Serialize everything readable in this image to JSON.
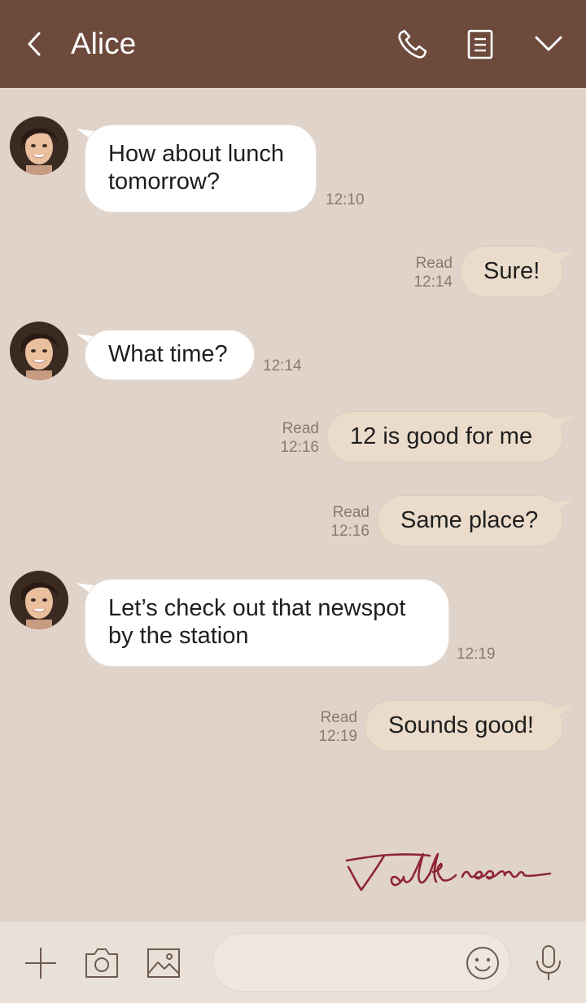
{
  "header": {
    "title": "Alice",
    "icons": [
      "back-arrow-icon",
      "phone-icon",
      "notes-icon",
      "chevron-down-icon"
    ],
    "background": "#6d4a3c"
  },
  "messages": [
    {
      "from": "Alice",
      "direction": "incoming",
      "text": "How about lunch\ntomorrow?",
      "time": "12:10"
    },
    {
      "from": "me",
      "direction": "outgoing",
      "text": "Sure!",
      "status": "Read",
      "time": "12:14"
    },
    {
      "from": "Alice",
      "direction": "incoming",
      "text": "What time?",
      "time": "12:14"
    },
    {
      "from": "me",
      "direction": "outgoing",
      "text": "12 is good for me",
      "status": "Read",
      "time": "12:16"
    },
    {
      "from": "me",
      "direction": "outgoing",
      "text": "Same place?",
      "status": "Read",
      "time": "12:16"
    },
    {
      "from": "Alice",
      "direction": "incoming",
      "text": "Let’s check out that newspot\nby the station",
      "time": "12:19"
    },
    {
      "from": "me",
      "direction": "outgoing",
      "text": "Sounds good!",
      "status": "Read",
      "time": "12:19"
    }
  ],
  "watermark": "Talk room",
  "bottom_bar": {
    "icons": [
      "plus-icon",
      "camera-icon",
      "image-icon",
      "emoji-icon",
      "microphone-icon"
    ],
    "message_value": ""
  },
  "colors": {
    "chat_background": "#e0d3c9",
    "incoming_bubble": "#ffffff",
    "outgoing_bubble": "#eadbcb",
    "watermark": "#8e2535"
  }
}
